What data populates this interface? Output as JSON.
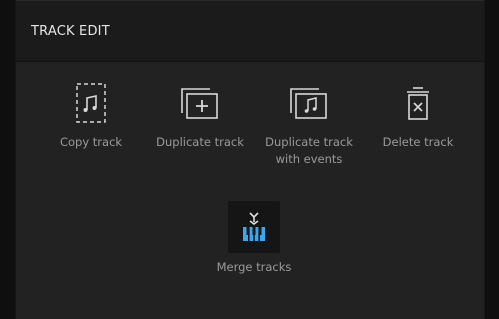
{
  "dialog": {
    "title": "TRACK EDIT"
  },
  "options": [
    {
      "label": "Copy track",
      "icon": "copy-track-icon"
    },
    {
      "label": "Duplicate track",
      "icon": "duplicate-track-icon"
    },
    {
      "label": "Duplicate track\nwith events",
      "icon": "duplicate-with-events-icon"
    },
    {
      "label": "Delete track",
      "icon": "trash-icon"
    },
    {
      "label": "Merge tracks",
      "icon": "merge-tracks-icon"
    }
  ],
  "colors": {
    "accent_blue": "#3aa7f0",
    "icon_light": "#d8d8d8"
  }
}
